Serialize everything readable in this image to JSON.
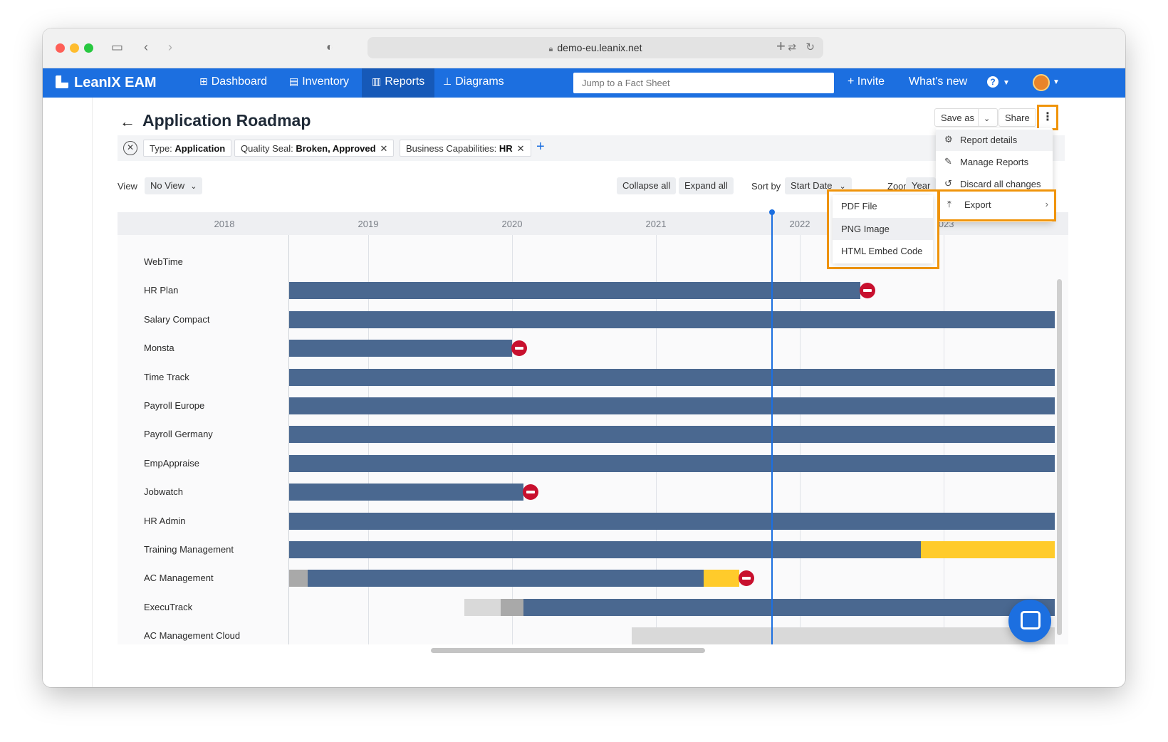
{
  "browser": {
    "url": "demo-eu.leanix.net"
  },
  "nav": {
    "brand": "LeanIX EAM",
    "items": [
      {
        "label": "Dashboard",
        "icon": "grid-icon"
      },
      {
        "label": "Inventory",
        "icon": "inventory-icon"
      },
      {
        "label": "Reports",
        "icon": "bar-chart-icon"
      },
      {
        "label": "Diagrams",
        "icon": "diagram-icon"
      }
    ],
    "search_placeholder": "Jump to a Fact Sheet",
    "invite": "+ Invite",
    "whats_new": "What's new",
    "help": "?"
  },
  "page": {
    "title": "Application Roadmap",
    "save_as": "Save as",
    "share": "Share"
  },
  "filters": [
    {
      "key": "Type:",
      "value": "Application",
      "removable": false
    },
    {
      "key": "Quality Seal:",
      "value": "Broken, Approved",
      "removable": true
    },
    {
      "key": "Business Capabilities:",
      "value": "HR",
      "removable": true
    }
  ],
  "controls": {
    "view_label": "View",
    "view_value": "No View",
    "collapse_all": "Collapse all",
    "expand_all": "Expand all",
    "sort_label": "Sort by",
    "sort_value": "Start Date",
    "zoom_label": "Zoom",
    "zoom_value": "Year"
  },
  "menu": {
    "items": [
      {
        "label": "Report details",
        "icon": "gear-icon"
      },
      {
        "label": "Manage Reports",
        "icon": "wrench-icon"
      },
      {
        "label": "Discard all changes",
        "icon": "undo-icon"
      }
    ],
    "export": "Export",
    "export_submenu": [
      "PDF File",
      "PNG Image",
      "HTML Embed Code"
    ]
  },
  "chart_data": {
    "type": "gantt",
    "x_axis": [
      "2018",
      "2019",
      "2020",
      "2021",
      "2022",
      "2023"
    ],
    "today_marker": "2021.8",
    "colors": {
      "active": "#4a6890",
      "phase_out": "#ffcb2b",
      "plan": "#a9a9a9",
      "phase_in": "#d9d9d9",
      "eol": "#c8102e"
    },
    "rows": [
      {
        "name": "WebTime",
        "segments": []
      },
      {
        "name": "HR Plan",
        "segments": [
          {
            "phase": "active",
            "start": 2018.45,
            "end": 2022.42
          }
        ],
        "eol": true
      },
      {
        "name": "Salary Compact",
        "segments": [
          {
            "phase": "active",
            "start": 2018.45,
            "end": 2023.77
          }
        ]
      },
      {
        "name": "Monsta",
        "segments": [
          {
            "phase": "active",
            "start": 2018.45,
            "end": 2020.0
          }
        ],
        "eol": true
      },
      {
        "name": "Time Track",
        "segments": [
          {
            "phase": "active",
            "start": 2018.45,
            "end": 2023.77
          }
        ]
      },
      {
        "name": "Payroll Europe",
        "segments": [
          {
            "phase": "active",
            "start": 2018.45,
            "end": 2023.77
          }
        ]
      },
      {
        "name": "Payroll Germany",
        "segments": [
          {
            "phase": "active",
            "start": 2018.45,
            "end": 2023.77
          }
        ]
      },
      {
        "name": "EmpAppraise",
        "segments": [
          {
            "phase": "active",
            "start": 2018.45,
            "end": 2023.77
          }
        ]
      },
      {
        "name": "Jobwatch",
        "segments": [
          {
            "phase": "active",
            "start": 2018.45,
            "end": 2020.08
          }
        ],
        "eol": true
      },
      {
        "name": "HR Admin",
        "segments": [
          {
            "phase": "active",
            "start": 2018.45,
            "end": 2023.77
          }
        ]
      },
      {
        "name": "Training Management",
        "segments": [
          {
            "phase": "active",
            "start": 2018.45,
            "end": 2022.84
          },
          {
            "phase": "phase_out",
            "start": 2022.84,
            "end": 2023.77
          }
        ]
      },
      {
        "name": "AC Management",
        "segments": [
          {
            "phase": "plan",
            "start": 2018.45,
            "end": 2018.58
          },
          {
            "phase": "active",
            "start": 2018.58,
            "end": 2021.33
          },
          {
            "phase": "phase_out",
            "start": 2021.33,
            "end": 2021.58
          }
        ],
        "eol": true
      },
      {
        "name": "ExecuTrack",
        "segments": [
          {
            "phase": "phase_in",
            "start": 2019.67,
            "end": 2019.92
          },
          {
            "phase": "plan",
            "start": 2019.92,
            "end": 2020.08
          },
          {
            "phase": "active",
            "start": 2020.08,
            "end": 2023.77
          }
        ]
      },
      {
        "name": "AC Management Cloud",
        "segments": [
          {
            "phase": "phase_in",
            "start": 2020.83,
            "end": 2023.77
          }
        ]
      }
    ]
  }
}
